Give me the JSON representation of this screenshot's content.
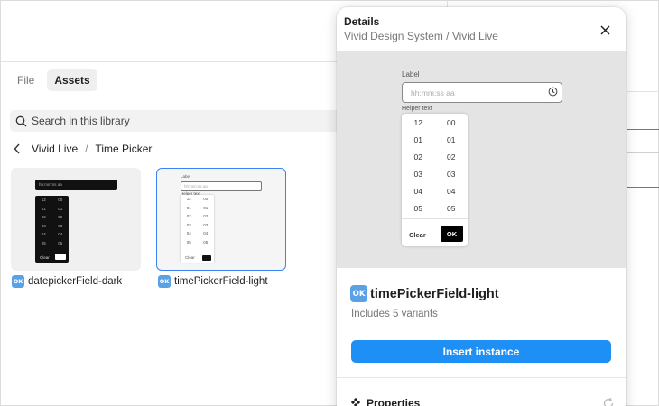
{
  "tabs": [
    "File",
    "Assets"
  ],
  "search": {
    "placeholder": "Search in this library"
  },
  "breadcrumb": {
    "library": "Vivid Live",
    "separator": "/",
    "current": "Time Picker"
  },
  "assets": [
    {
      "label": "datepickerField-dark",
      "badge": "OK"
    },
    {
      "label": "timePickerField-light",
      "badge": "OK"
    }
  ],
  "mini_preview": {
    "placeholder": "hh:mm:ss aa",
    "label": "Label",
    "helper": "Helper text",
    "clear": "Clear",
    "ok": "OK",
    "rows": [
      [
        "12",
        "00"
      ],
      [
        "01",
        "01"
      ],
      [
        "02",
        "02"
      ],
      [
        "03",
        "03"
      ],
      [
        "04",
        "04"
      ],
      [
        "05",
        "05"
      ]
    ]
  },
  "details": {
    "title": "Details",
    "subtitle": "Vivid Design System / Vivid Live",
    "preview": {
      "label": "Label",
      "placeholder": "hh:mm:ss aa",
      "helper": "Helper text",
      "rows": [
        [
          "12",
          "00"
        ],
        [
          "01",
          "01"
        ],
        [
          "02",
          "02"
        ],
        [
          "03",
          "03"
        ],
        [
          "04",
          "04"
        ],
        [
          "05",
          "05"
        ]
      ],
      "clear": "Clear",
      "ok": "OK"
    },
    "component_name": "timePickerField-light",
    "badge": "OK",
    "variants": "Includes 5 variants",
    "insert_label": "Insert instance",
    "properties_label": "Properties"
  },
  "colors": {
    "accent": "#1e90f5",
    "selection": "#3b82f6",
    "badge": "#5aa2e6",
    "panel_line_purple": "#9b59b6"
  }
}
